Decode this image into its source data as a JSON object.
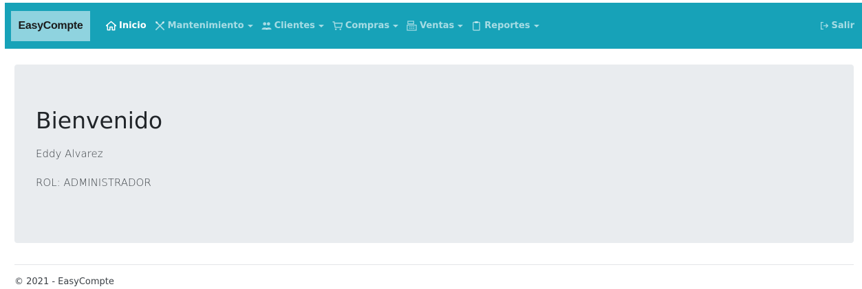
{
  "navbar": {
    "brand": "EasyCompte",
    "background": "#17a2b8",
    "items": [
      {
        "label": "Inicio",
        "icon": "home-icon",
        "active": true,
        "dropdown": false
      },
      {
        "label": "Mantenimiento",
        "icon": "tools-icon",
        "active": false,
        "dropdown": true
      },
      {
        "label": "Clientes",
        "icon": "users-icon",
        "active": false,
        "dropdown": true
      },
      {
        "label": "Compras",
        "icon": "cart-icon",
        "active": false,
        "dropdown": true
      },
      {
        "label": "Ventas",
        "icon": "register-icon",
        "active": false,
        "dropdown": true
      },
      {
        "label": "Reportes",
        "icon": "clipboard-icon",
        "active": false,
        "dropdown": true
      }
    ],
    "logout": {
      "label": "Salir",
      "icon": "sign-out-icon"
    }
  },
  "main": {
    "title": "Bienvenido",
    "user_name": "Eddy Alvarez",
    "role": "ROL: ADMINISTRADOR"
  },
  "footer": {
    "text": "© 2021 - EasyCompte"
  }
}
